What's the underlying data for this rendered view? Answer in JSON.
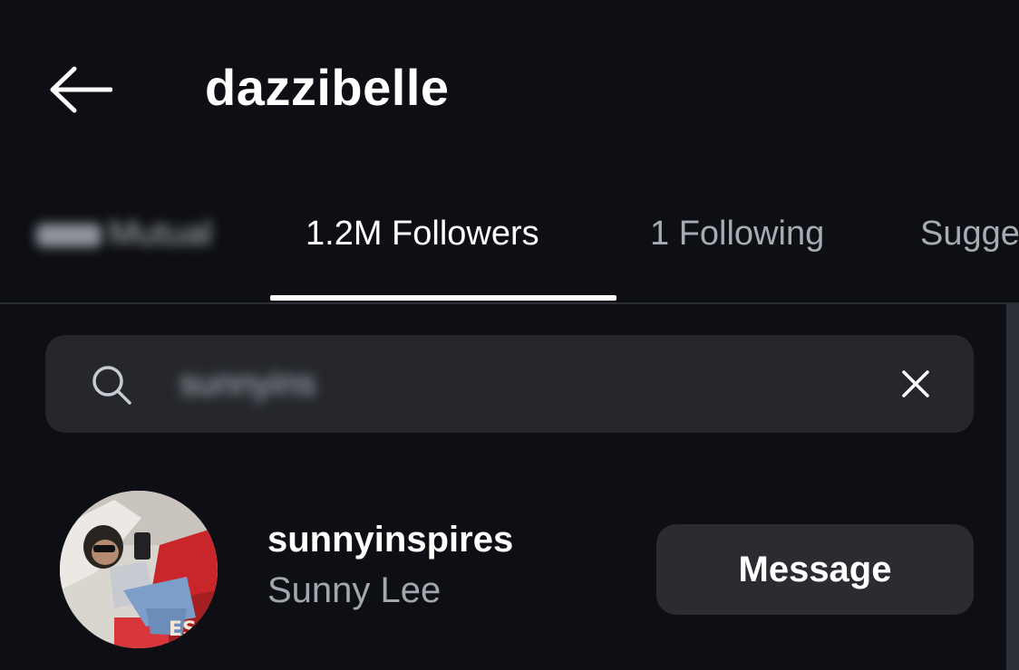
{
  "header": {
    "title": "dazzibelle",
    "back_icon": "arrow-left-icon"
  },
  "tabs": [
    {
      "label": "Mutual",
      "blurred": true
    },
    {
      "label": "1.2M Followers",
      "active": true
    },
    {
      "label": "1 Following"
    },
    {
      "label": "Sugge"
    }
  ],
  "search": {
    "value": "sunnyins",
    "search_icon": "search-icon",
    "clear_icon": "close-icon"
  },
  "results": [
    {
      "username": "sunnyinspires",
      "full_name": "Sunny Lee",
      "button_label": "Message"
    }
  ],
  "colors": {
    "background": "#0d0f14",
    "surface": "#25272d",
    "button": "#2a2c32",
    "text_primary": "#ffffff",
    "text_secondary": "#a3a6ad"
  }
}
